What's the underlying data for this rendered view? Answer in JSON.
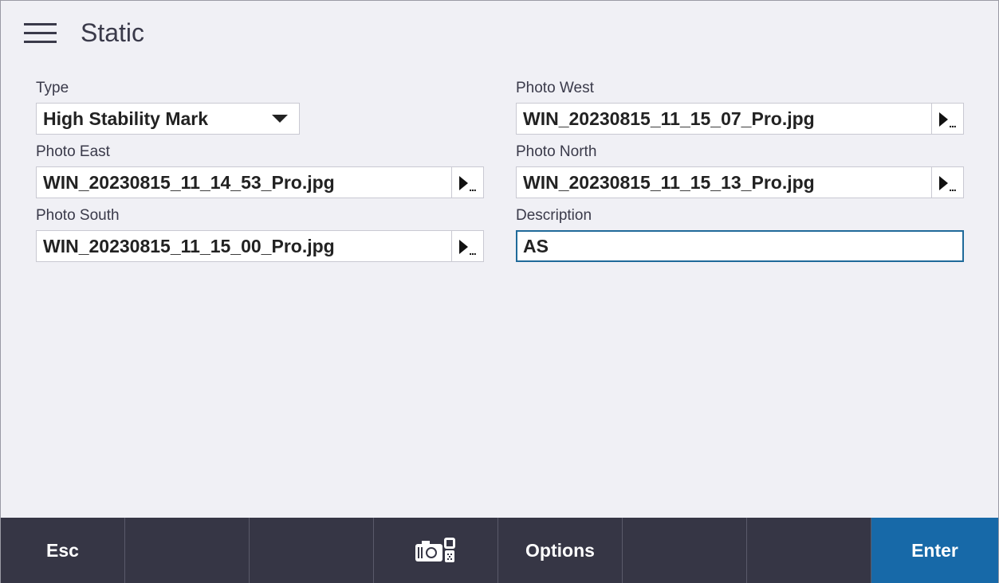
{
  "header": {
    "menu_icon": "hamburger-menu-icon",
    "title": "Static"
  },
  "form": {
    "type": {
      "label": "Type",
      "value": "High Stability Mark"
    },
    "photo_east": {
      "label": "Photo East",
      "value": "WIN_20230815_11_14_53_Pro.jpg"
    },
    "photo_south": {
      "label": "Photo South",
      "value": "WIN_20230815_11_15_00_Pro.jpg"
    },
    "photo_west": {
      "label": "Photo West",
      "value": "WIN_20230815_11_15_07_Pro.jpg"
    },
    "photo_north": {
      "label": "Photo North",
      "value": "WIN_20230815_11_15_13_Pro.jpg"
    },
    "description": {
      "label": "Description",
      "value": "AS"
    }
  },
  "toolbar": {
    "esc_label": "Esc",
    "camera_icon": "camera-icon",
    "options_label": "Options",
    "enter_label": "Enter"
  },
  "colors": {
    "background": "#f0f0f5",
    "toolbar": "#363645",
    "enter_accent": "#1769a8",
    "focus_border": "#1f6a9a"
  }
}
